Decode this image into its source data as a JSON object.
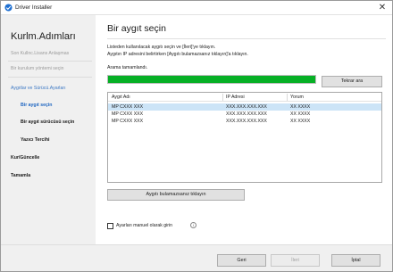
{
  "window": {
    "title": "Driver Installer"
  },
  "sidebar": {
    "heading": "Kurlm.Adımları",
    "steps": [
      {
        "label": "Son Kullnc.Lisans Anlaşmas"
      },
      {
        "label": "Bir kurulum yöntemi seçin"
      },
      {
        "label": "Aygıtlar ve Sürücü.Ayarları"
      },
      {
        "label": "Bir aygıt seçin"
      },
      {
        "label": "Bir aygıt sürücüsü seçin"
      },
      {
        "label": "Yazıcı Tercihi"
      },
      {
        "label": "Kur/Güncelle"
      },
      {
        "label": "Tamamla"
      }
    ]
  },
  "main": {
    "title": "Bir aygıt seçin",
    "instruction_line1": "Listeden kullanılacak aygıtı seçin ve [İleri]'ye tıklayın.",
    "instruction_line2": "Aygıtın IP adresini belirtirken [Aygıtı bulamazsanız tıklayın]'a tıklayın.",
    "status": "Arama tamamlandı.",
    "progress_fraction": 1.0,
    "retry_button": "Tekrar ara",
    "table": {
      "columns": [
        "Aygıt Adı",
        "IP Adresi",
        "Yorum"
      ],
      "rows": [
        [
          "MP CXXX XXX",
          "XXX.XXX.XXX.XXX",
          "XX XXXX"
        ],
        [
          "MP CXXX XXX",
          "XXX.XXX.XXX.XXX",
          "XX XXXX"
        ],
        [
          "MP CXXX XXX",
          "XXX.XXX.XXX.XXX",
          "XX XXXX"
        ]
      ]
    },
    "not_found_button": "Aygıtı bulamazsanız tıklayın",
    "manual_checkbox_label": "Ayarları manuel olarak girin",
    "manual_checked": false
  },
  "footer": {
    "back_label": "Geri",
    "next_label": "İleri",
    "cancel_label": "İptal"
  },
  "colors": {
    "progress": "#06b025",
    "selected_row": "#cce4f7",
    "active_step": "#1f66c1"
  }
}
